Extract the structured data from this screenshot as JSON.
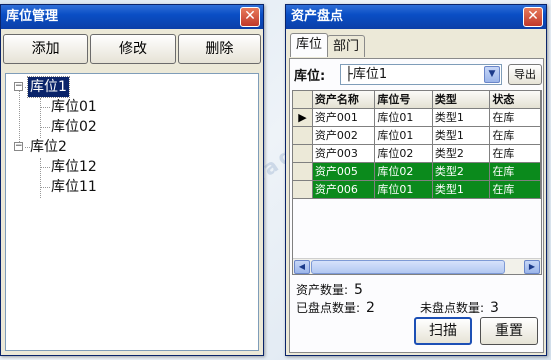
{
  "left_window": {
    "title": "库位管理",
    "close_glyph": "✕",
    "buttons": {
      "add": "添加",
      "edit": "修改",
      "delete": "删除"
    },
    "tree": {
      "node1": {
        "toggle": "−",
        "label": "库位1",
        "children": [
          "库位01",
          "库位02"
        ]
      },
      "node2": {
        "toggle": "−",
        "label": "库位2",
        "children": [
          "库位12",
          "库位11"
        ]
      }
    }
  },
  "right_window": {
    "title": "资产盘点",
    "close_glyph": "✕",
    "tabs": [
      "库位",
      "部门"
    ],
    "location_label": "库位:",
    "location_value": "├库位1",
    "export_label": "导出",
    "grid": {
      "columns": [
        "资产名称",
        "库位号",
        "类型",
        "状态"
      ],
      "current_row_marker": "▶",
      "rows": [
        {
          "name": "资产001",
          "location": "库位01",
          "type": "类型1",
          "status": "在库",
          "highlight": false,
          "current": true
        },
        {
          "name": "资产002",
          "location": "库位01",
          "type": "类型1",
          "status": "在库",
          "highlight": false,
          "current": false
        },
        {
          "name": "资产003",
          "location": "库位02",
          "type": "类型2",
          "status": "在库",
          "highlight": false,
          "current": false
        },
        {
          "name": "资产005",
          "location": "库位02",
          "type": "类型2",
          "status": "在库",
          "highlight": true,
          "current": false
        },
        {
          "name": "资产006",
          "location": "库位01",
          "type": "类型1",
          "status": "在库",
          "highlight": true,
          "current": false
        }
      ]
    },
    "stats": {
      "asset_count_label": "资产数量:",
      "asset_count": "5",
      "checked_label": "已盘点数量:",
      "checked": "2",
      "unchecked_label": "未盘点数量:",
      "unchecked": "3"
    },
    "actions": {
      "scan": "扫描",
      "reset": "重置"
    }
  },
  "watermarks": [
    "探感物联",
    "www.etag-rfid.com",
    "探感物联"
  ],
  "colors": {
    "titlebar": "#0a4ec5",
    "highlight_row": "#0b8a1c",
    "selected_tree": "#0a246a"
  },
  "icons": {
    "close": "close-icon",
    "dropdown": "chevron-down-icon",
    "row_pointer": "row-pointer-icon"
  }
}
